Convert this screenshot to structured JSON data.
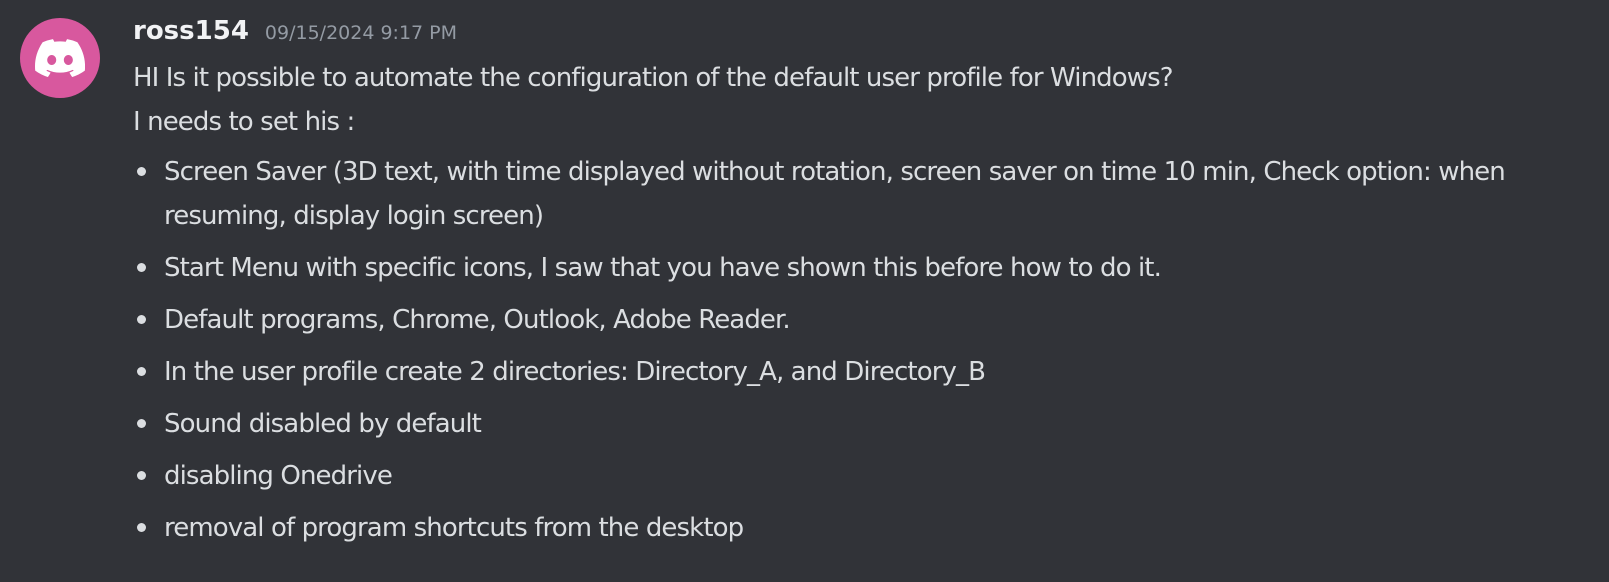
{
  "message": {
    "avatar_icon": "discord-logo-icon",
    "avatar_color": "#d8589e",
    "username": "ross154",
    "timestamp": "09/15/2024 9:17 PM",
    "lines": [
      "HI Is it possible to automate the configuration of the default user profile for Windows?",
      "I needs to set his :"
    ],
    "bullets": [
      "Screen Saver (3D text, with time displayed without rotation, screen saver on time 10 min, Check option: when resuming, display login screen)",
      "Start Menu with specific icons, I saw that you have shown this before how to do it.",
      "Default programs, Chrome, Outlook, Adobe Reader.",
      "In the user profile create 2 directories: Directory_A, and Directory_B",
      "Sound disabled by default",
      "disabling Onedrive",
      "removal of program shortcuts from the desktop"
    ]
  },
  "colors": {
    "background": "#313338",
    "text": "#dbdee1",
    "username": "#f2f3f5",
    "timestamp": "#949ba4"
  }
}
